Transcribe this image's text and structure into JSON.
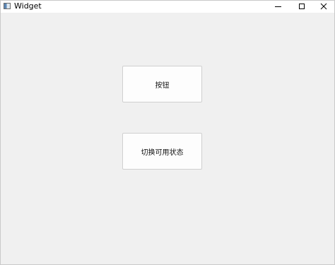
{
  "window": {
    "title": "Widget",
    "app_icon": "window-icon",
    "controls": {
      "minimize_icon": "minimize-icon",
      "maximize_icon": "maximize-icon",
      "close_icon": "close-icon"
    }
  },
  "buttons": {
    "primary_label": "按钮",
    "toggle_label": "切换可用状态"
  },
  "colors": {
    "client_bg": "#f0f0f0",
    "titlebar_bg": "#ffffff",
    "button_bg": "#fdfdfd",
    "button_border": "#d0d0d0"
  }
}
